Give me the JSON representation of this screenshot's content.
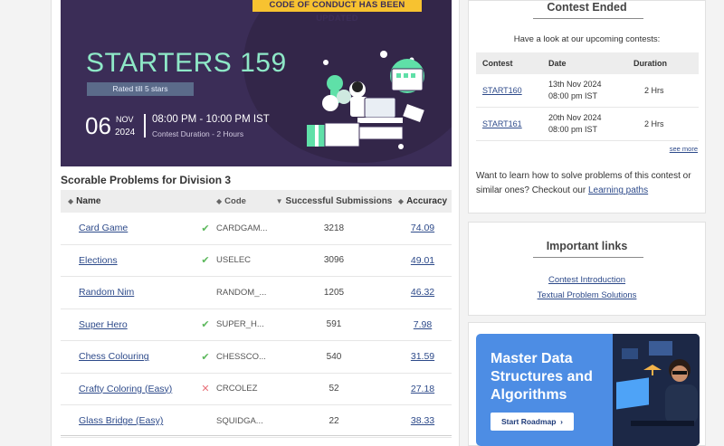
{
  "banner": {
    "conduct_notice": "CODE OF CONDUCT HAS BEEN UPDATED",
    "contest_name": "STARTERS 159",
    "rated": "Rated till 5 stars",
    "day": "06",
    "month": "NOV",
    "year": "2024",
    "time_range": "08:00 PM - 10:00 PM IST",
    "duration": "Contest Duration - 2 Hours"
  },
  "problems": {
    "title": "Scorable Problems for Division 3",
    "headers": {
      "name": "Name",
      "code": "Code",
      "successful": "Successful Submissions",
      "accuracy": "Accuracy"
    },
    "rows": [
      {
        "name": "Card Game",
        "status": "solved",
        "mark": "✔",
        "code": "CARDGAM...",
        "successful": "3218",
        "accuracy": "74.09"
      },
      {
        "name": "Elections",
        "status": "solved",
        "mark": "✔",
        "code": "USELEC",
        "successful": "3096",
        "accuracy": "49.01"
      },
      {
        "name": "Random Nim",
        "status": "",
        "mark": "",
        "code": "RANDOM_...",
        "successful": "1205",
        "accuracy": "46.32"
      },
      {
        "name": "Super Hero",
        "status": "solved",
        "mark": "✔",
        "code": "SUPER_H...",
        "successful": "591",
        "accuracy": "7.98"
      },
      {
        "name": "Chess Colouring",
        "status": "solved",
        "mark": "✔",
        "code": "CHESSCO...",
        "successful": "540",
        "accuracy": "31.59"
      },
      {
        "name": "Crafty Coloring (Easy)",
        "status": "wrong",
        "mark": "✕",
        "code": "CRCOLEZ",
        "successful": "52",
        "accuracy": "27.18"
      },
      {
        "name": "Glass Bridge (Easy)",
        "status": "",
        "mark": "",
        "code": "SQUIDGA...",
        "successful": "22",
        "accuracy": "38.33"
      }
    ]
  },
  "ended": {
    "title": "Contest Ended",
    "upcoming_text": "Have a look at our upcoming contests:",
    "headers": {
      "contest": "Contest",
      "date": "Date",
      "duration": "Duration"
    },
    "rows": [
      {
        "contest": "START160",
        "date": "13th Nov 2024",
        "time": "08:00 pm IST",
        "duration": "2 Hrs"
      },
      {
        "contest": "START161",
        "date": "20th Nov 2024",
        "time": "08:00 pm IST",
        "duration": "2 Hrs"
      }
    ],
    "see_more": "see more",
    "learn_text": "Want to learn how to solve problems of this contest or similar ones? Checkout our",
    "learn_link": "Learning paths"
  },
  "links": {
    "title": "Important links",
    "items": [
      "Contest Introduction",
      "Textual Problem Solutions"
    ]
  },
  "ad": {
    "line1": "Master Data",
    "line2": "Structures and",
    "line3": "Algorithms",
    "button": "Start Roadmap"
  },
  "colors": {
    "banner_bg": "#3b2d57",
    "banner_accent": "#8ee8c7",
    "notice_bg": "#f7c230",
    "link": "#2d4a8a",
    "check": "#5cb85c",
    "cross": "#e8717a",
    "ad_bg": "#4d8de4"
  }
}
